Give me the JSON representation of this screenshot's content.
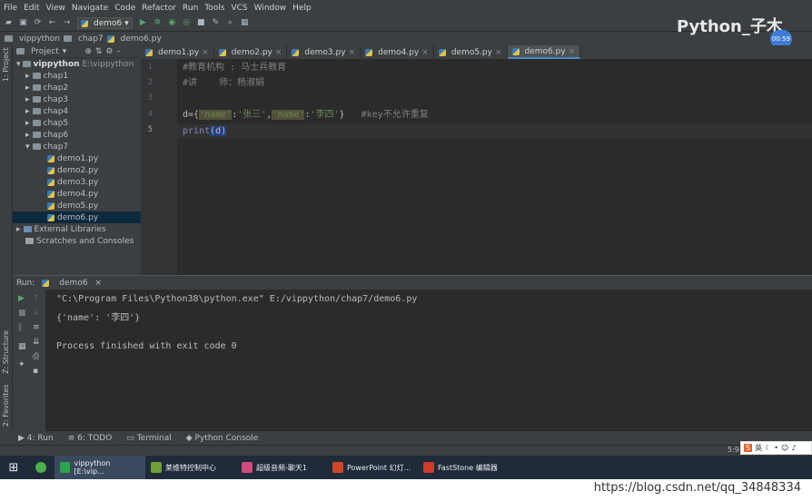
{
  "menu": [
    "File",
    "Edit",
    "View",
    "Navigate",
    "Code",
    "Refactor",
    "Run",
    "Tools",
    "VCS",
    "Window",
    "Help"
  ],
  "toolbar": {
    "run_config": "demo6"
  },
  "breadcrumb": [
    "vippython",
    "chap7",
    "demo6.py"
  ],
  "left_strip": {
    "project": "1: Project",
    "structure": "Z: Structure",
    "favorites": "2: Favorites"
  },
  "project_panel": {
    "header": "Project",
    "root_name": "vippython",
    "root_path": "E:\\vippython",
    "items": [
      {
        "type": "folder",
        "label": "chap1",
        "level": 1
      },
      {
        "type": "folder",
        "label": "chap2",
        "level": 1
      },
      {
        "type": "folder",
        "label": "chap3",
        "level": 1
      },
      {
        "type": "folder",
        "label": "chap4",
        "level": 1
      },
      {
        "type": "folder",
        "label": "chap5",
        "level": 1
      },
      {
        "type": "folder",
        "label": "chap6",
        "level": 1
      },
      {
        "type": "folder",
        "label": "chap7",
        "level": 1,
        "expanded": true
      },
      {
        "type": "file",
        "label": "demo1.py",
        "level": 2
      },
      {
        "type": "file",
        "label": "demo2.py",
        "level": 2
      },
      {
        "type": "file",
        "label": "demo3.py",
        "level": 2
      },
      {
        "type": "file",
        "label": "demo4.py",
        "level": 2
      },
      {
        "type": "file",
        "label": "demo5.py",
        "level": 2
      },
      {
        "type": "file",
        "label": "demo6.py",
        "level": 2,
        "selected": true
      },
      {
        "type": "lib",
        "label": "External Libraries",
        "level": 0
      },
      {
        "type": "scratch",
        "label": "Scratches and Consoles",
        "level": 0
      }
    ]
  },
  "tabs": [
    "demo1.py",
    "demo2.py",
    "demo3.py",
    "demo4.py",
    "demo5.py",
    "demo6.py"
  ],
  "active_tab": "demo6.py",
  "line_numbers": [
    "1",
    "2",
    "3",
    "4",
    "5"
  ],
  "code": {
    "line1": "#教育机构 : 马士兵教育",
    "line2": "#讲    师：杨淑娟",
    "line4_pre": "d=",
    "line4_brace_open": "{",
    "line4_s1": "'name'",
    "line4_colon1": ":",
    "line4_v1": "'张三'",
    "line4_comma": ",",
    "line4_s2": "'name'",
    "line4_colon2": ":",
    "line4_v2": "'李四'",
    "line4_brace_close": "}",
    "line4_comment": "#key不允许重复",
    "line5_fn": "print",
    "line5_paren": "(d)"
  },
  "run_panel": {
    "label": "Run:",
    "tab": "demo6"
  },
  "console": {
    "line1": "\"C:\\Program Files\\Python38\\python.exe\" E:/vippython/chap7/demo6.py",
    "line2": "{'name': '李四'}",
    "line3": "Process finished with exit code 0"
  },
  "bottom_tabs": [
    "4: Run",
    "6: TODO",
    "Terminal",
    "Python Console"
  ],
  "status": {
    "position": "5:9"
  },
  "taskbar": [
    {
      "label": "vippython [E:\\vip...",
      "color": "#2aa44f",
      "active": true
    },
    {
      "label": "莱维特控制中心",
      "color": "#6fa03a"
    },
    {
      "label": "超级音频-聊天1",
      "color": "#d14a7b"
    },
    {
      "label": "PowerPoint 幻灯...",
      "color": "#d24726"
    },
    {
      "label": "FastStone 编辑器",
      "color": "#d23a2a"
    }
  ],
  "overlay": {
    "title": "Python_子木",
    "timer": "00:59"
  },
  "ime": {
    "label": "英"
  },
  "watermark": "https://blog.csdn.net/qq_34848334"
}
